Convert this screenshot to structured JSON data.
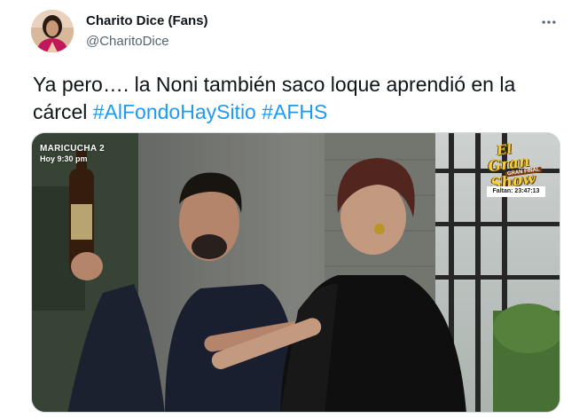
{
  "tweet": {
    "author": {
      "display_name": "Charito Dice (Fans)",
      "handle": "@CharitoDice"
    },
    "text_parts": {
      "plain": "Ya pero…. la Noni también saco loque aprendió en la cárcel ",
      "hashtag_1": "#AlFondoHaySitio",
      "separator": " ",
      "hashtag_2": "#AFHS"
    },
    "media": {
      "overlay_channel": "MARICUCHA 2",
      "overlay_time": "Hoy 9:30 pm",
      "logo_line1": "El",
      "logo_line2": "Gran Show",
      "logo_line3": "GRAN FINAL",
      "countdown": "Faltan: 23:47:13"
    },
    "icons": {
      "more": "more-horizontal-icon",
      "avatar": "user-avatar"
    },
    "colors": {
      "accent": "#1d9bf0",
      "text": "#0f1419",
      "secondary": "#536471",
      "border": "#cfd9de"
    }
  }
}
